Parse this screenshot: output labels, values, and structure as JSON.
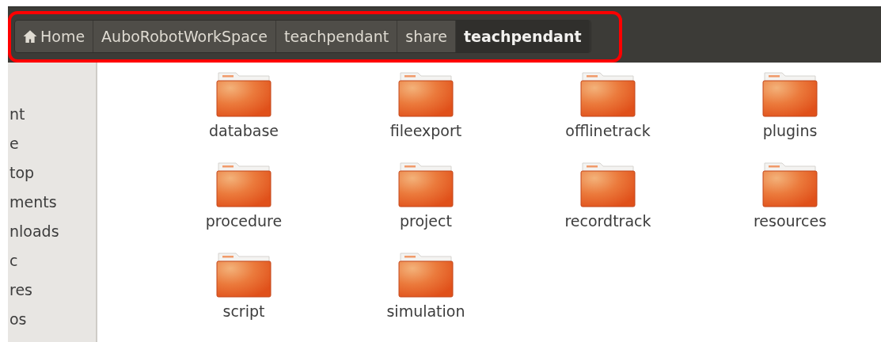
{
  "breadcrumbs": [
    {
      "label": "Home",
      "kind": "home",
      "selected": false
    },
    {
      "label": "AuboRobotWorkSpace",
      "kind": "folder",
      "selected": false
    },
    {
      "label": "teachpendant",
      "kind": "folder",
      "selected": false
    },
    {
      "label": "share",
      "kind": "folder",
      "selected": false
    },
    {
      "label": "teachpendant",
      "kind": "folder",
      "selected": true
    }
  ],
  "highlight": {
    "color": "#ff0000"
  },
  "sidebar": {
    "items": [
      "nt",
      "e",
      "top",
      "ments",
      "nloads",
      "c",
      "res",
      "os"
    ]
  },
  "files": [
    {
      "name": "database"
    },
    {
      "name": "fileexport"
    },
    {
      "name": "offlinetrack"
    },
    {
      "name": "plugins"
    },
    {
      "name": "procedure"
    },
    {
      "name": "project"
    },
    {
      "name": "recordtrack"
    },
    {
      "name": "resources"
    },
    {
      "name": "script"
    },
    {
      "name": "simulation"
    }
  ]
}
